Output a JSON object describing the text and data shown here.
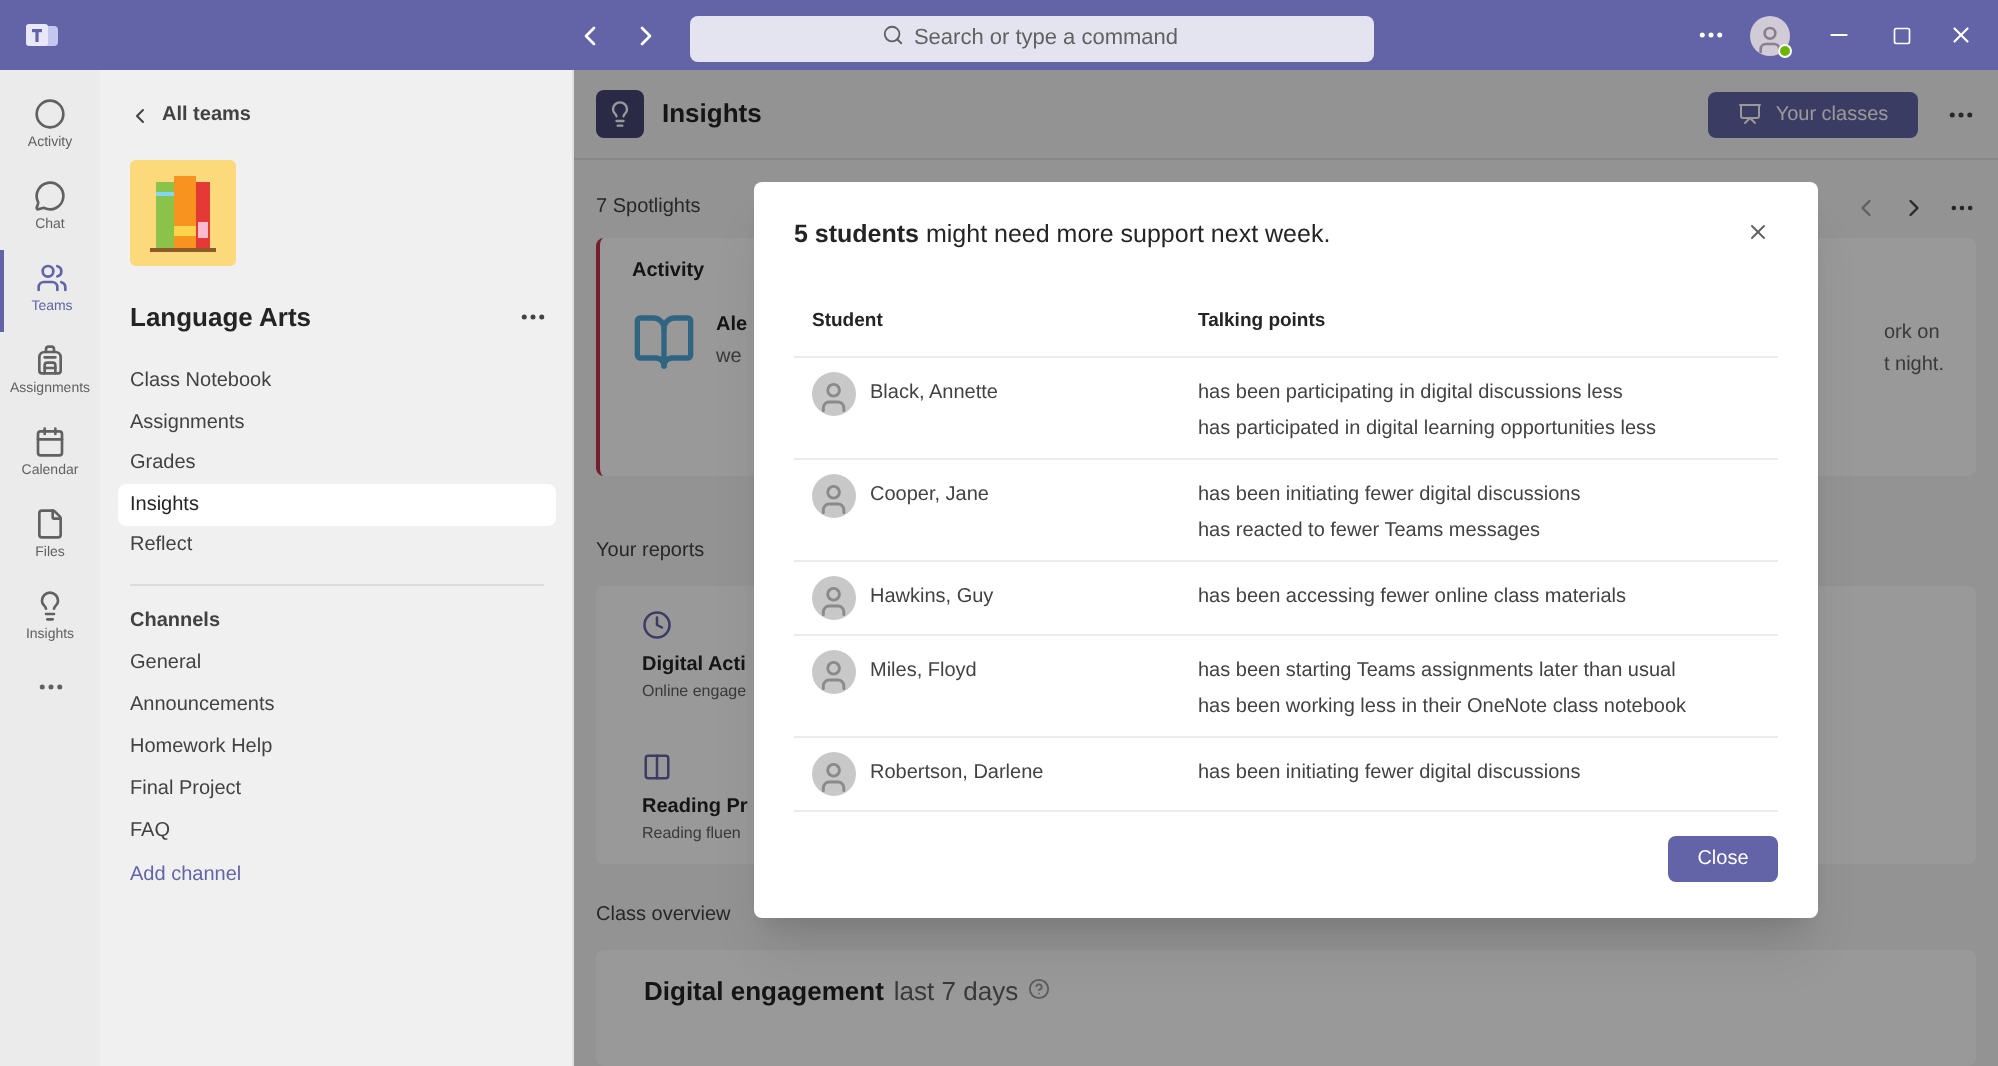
{
  "title_bar": {
    "search_placeholder": "Search or type a command"
  },
  "rail": [
    {
      "label": "Activity",
      "kind": "activity",
      "selected": false
    },
    {
      "label": "Chat",
      "kind": "chat",
      "selected": false
    },
    {
      "label": "Teams",
      "kind": "teams",
      "selected": true
    },
    {
      "label": "Assignments",
      "kind": "assignments",
      "selected": false
    },
    {
      "label": "Calendar",
      "kind": "calendar",
      "selected": false
    },
    {
      "label": "Files",
      "kind": "files",
      "selected": false
    },
    {
      "label": "Insights",
      "kind": "insights",
      "selected": false
    }
  ],
  "team_panel": {
    "back_link": "All teams",
    "team_name": "Language Arts",
    "tabs": [
      {
        "label": "Class Notebook",
        "selected": false
      },
      {
        "label": "Assignments",
        "selected": false
      },
      {
        "label": "Grades",
        "selected": false
      },
      {
        "label": "Insights",
        "selected": true
      },
      {
        "label": "Reflect",
        "selected": false
      }
    ],
    "channels_heading": "Channels",
    "channels": [
      "General",
      "Announcements",
      "Homework Help",
      "Final Project",
      "FAQ"
    ],
    "add_channel": "Add channel"
  },
  "main": {
    "title": "Insights",
    "your_classes": "Your classes",
    "spotlights_label": "7 Spotlights",
    "spotlight_card": {
      "heading": "Activity",
      "left_lines": [
        "Ale",
        "we"
      ],
      "right_lines": [
        "ork on",
        "t night."
      ]
    },
    "reports_heading": "Your reports",
    "reports": [
      {
        "kind": "clock",
        "title": "Digital Acti",
        "subtitle": "Online engage"
      },
      {
        "kind": "book",
        "title": "Reading Pr",
        "subtitle": "Reading fluen"
      }
    ],
    "overview_heading": "Class overview",
    "overview_card": {
      "title": "Digital engagement",
      "period": "last 7 days"
    }
  },
  "dialog": {
    "headline": "**5 students** might need more support next week.",
    "columns": [
      "Student",
      "Talking points"
    ],
    "rows": [
      {
        "name": "Black, Annette",
        "points": [
          "has been participating in digital discussions less",
          "has participated in digital learning opportunities less"
        ]
      },
      {
        "name": "Cooper, Jane",
        "points": [
          "has been initiating fewer digital discussions",
          "has reacted to fewer Teams messages"
        ]
      },
      {
        "name": "Hawkins, Guy",
        "points": [
          "has been accessing fewer online class materials"
        ]
      },
      {
        "name": "Miles, Floyd",
        "points": [
          "has been starting Teams assignments later than usual",
          "has been working less in their OneNote class notebook"
        ]
      },
      {
        "name": "Robertson, Darlene",
        "points": [
          "has been initiating fewer digital discussions"
        ]
      }
    ],
    "close_button": "Close"
  }
}
